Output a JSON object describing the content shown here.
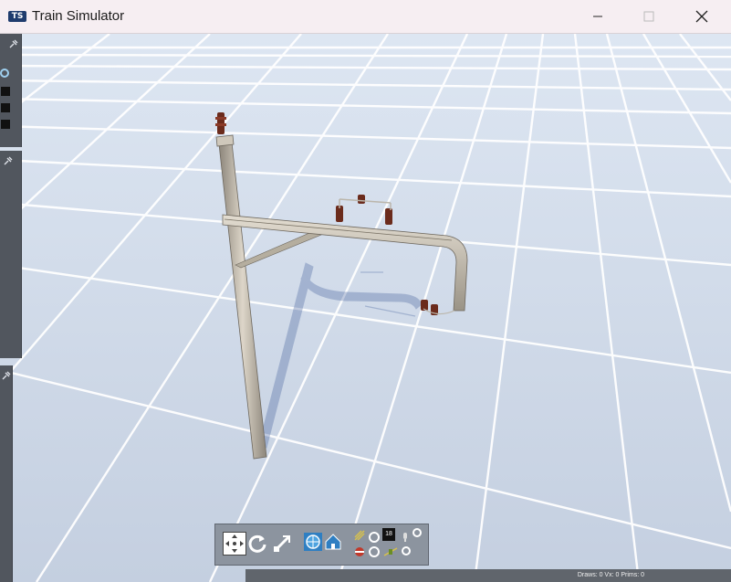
{
  "window": {
    "title": "Train Simulator",
    "logo_text": "TS",
    "controls": [
      "minimize",
      "maximize",
      "close"
    ]
  },
  "toolbar": {
    "tools": [
      "move-icon",
      "rotate-icon",
      "scale-icon",
      "globe-icon",
      "home-icon"
    ],
    "counter_value": "18"
  },
  "status_bar": {
    "text": "Draws: 0 Vx: 0 Prims: 0"
  }
}
